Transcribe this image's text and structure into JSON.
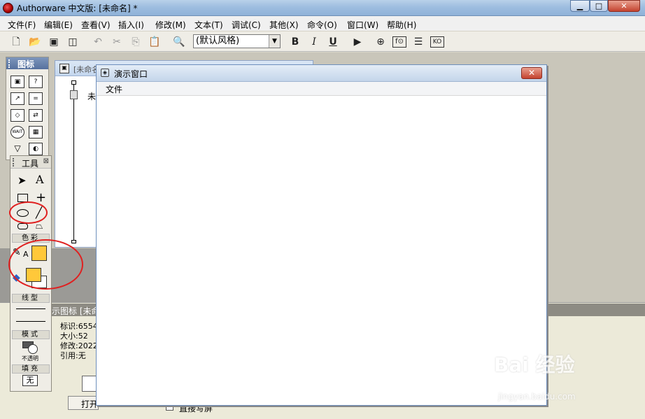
{
  "app": {
    "title": "Authorware 中文版: [未命名] *"
  },
  "menubar": [
    "文件(F)",
    "编辑(E)",
    "查看(V)",
    "插入(I)",
    "修改(M)",
    "文本(T)",
    "调试(C)",
    "其他(X)",
    "命令(O)",
    "窗口(W)",
    "帮助(H)"
  ],
  "toolbar": {
    "style_select_value": "(默认风格)",
    "bold": "B",
    "italic": "I",
    "underline": "U"
  },
  "flow_window": {
    "title": "[未命名",
    "item_label": "未"
  },
  "icon_palette": {
    "title": "图标"
  },
  "tool_palette": {
    "title": "工具",
    "color_section": "色彩",
    "line_section": "线型",
    "mode_section": "模式",
    "mode_value": "不透明",
    "fill_section": "填充",
    "fill_value": "无",
    "text_tool": "A",
    "color_swatch": "#ffc83a"
  },
  "demo_window": {
    "title": "演示窗口",
    "menu_file": "文件"
  },
  "properties": {
    "title": "示图标 [未命",
    "id_label": "标识:6554",
    "size_label": "大小:52 ",
    "modified_label": "修改:2022",
    "ref_label": "引用:无",
    "open_button": "打开",
    "checkbox_label": "直接写屏"
  },
  "watermark": {
    "text": "Bai 经验",
    "url": "jingyan.baidu.com"
  }
}
